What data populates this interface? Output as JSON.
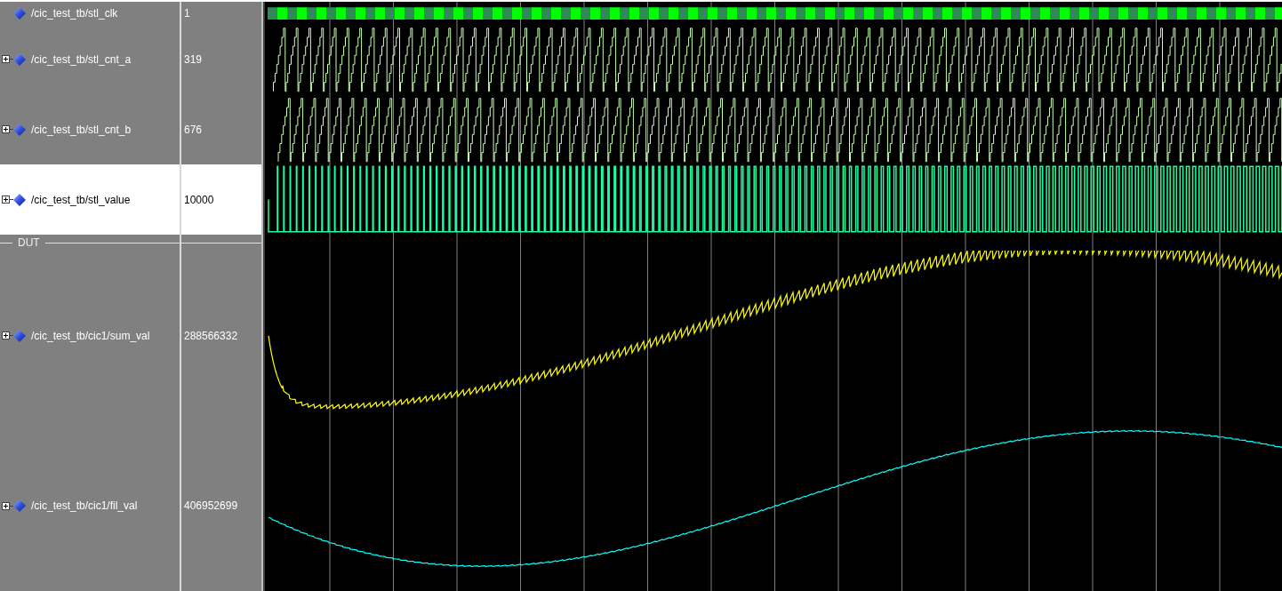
{
  "rows": [
    {
      "kind": "clock",
      "name": "/cic_test_tb/stl_clk",
      "value": "1",
      "expandable": false,
      "selected": false,
      "color": "#00ff00"
    },
    {
      "kind": "counter",
      "name": "/cic_test_tb/stl_cnt_a",
      "value": "319",
      "expandable": true,
      "selected": false,
      "color": "#c8ffb0"
    },
    {
      "kind": "counter",
      "name": "/cic_test_tb/stl_cnt_b",
      "value": "676",
      "expandable": true,
      "selected": false,
      "color": "#c8ffb0"
    },
    {
      "kind": "pulse",
      "name": "/cic_test_tb/stl_value",
      "value": "10000",
      "expandable": true,
      "selected": true,
      "color": "#1affa0"
    },
    {
      "kind": "divider",
      "label": "DUT"
    },
    {
      "kind": "ripple",
      "name": "/cic_test_tb/cic1/sum_val",
      "value": "288566332",
      "expandable": true,
      "selected": false,
      "color": "#ffff00"
    },
    {
      "kind": "smooth",
      "name": "/cic_test_tb/cic1/fil_val",
      "value": "406952699",
      "expandable": true,
      "selected": false,
      "color": "#00ffff"
    }
  ]
}
